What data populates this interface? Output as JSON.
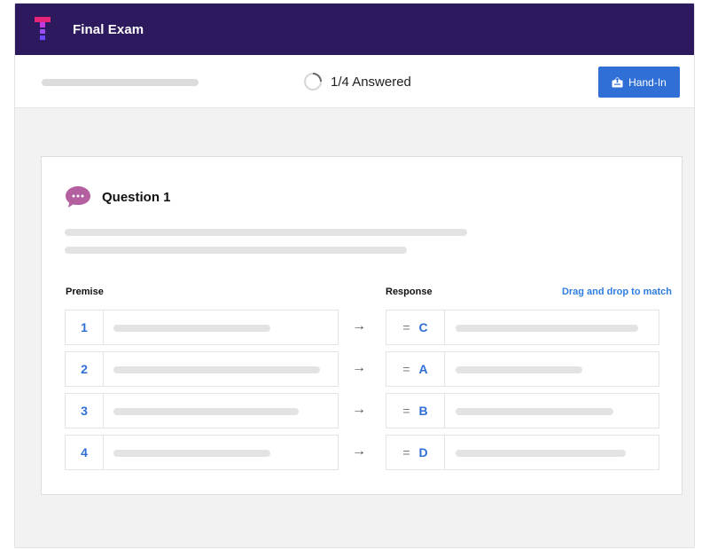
{
  "header": {
    "title": "Final Exam"
  },
  "status": {
    "answered_text": "1/4 Answered",
    "answered_fraction": 0.25,
    "handin_label": "Hand-In"
  },
  "question": {
    "title": "Question 1",
    "premise_label": "Premise",
    "response_label": "Response",
    "hint": "Drag and drop to match",
    "rows": [
      {
        "number": "1",
        "response_letter": "C"
      },
      {
        "number": "2",
        "response_letter": "A"
      },
      {
        "number": "3",
        "response_letter": "B"
      },
      {
        "number": "4",
        "response_letter": "D"
      }
    ]
  },
  "colors": {
    "header_bg": "#2d1a5e",
    "accent": "#2f6fd6",
    "question_icon": "#b45fa0"
  },
  "icons": {
    "logo": "logo-icon",
    "progress": "progress-ring-icon",
    "handin": "upload-icon",
    "question": "chat-bubble-icon",
    "arrow": "arrow-right-icon",
    "grip": "drag-handle-icon"
  }
}
